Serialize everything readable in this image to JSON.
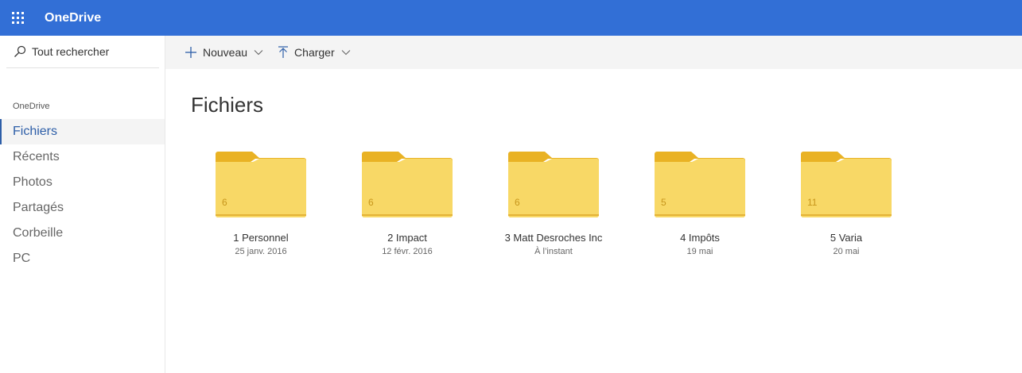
{
  "app": {
    "brand": "OneDrive"
  },
  "icons": {
    "launcher": "app-launcher-icon",
    "search": "search-icon",
    "new": "plus-icon",
    "upload": "upload-icon",
    "folder": "folder-icon",
    "chevron": "chevron-down-icon"
  },
  "colors": {
    "topbar": "#326fd6",
    "accent": "#2d5ea8",
    "folder": "#f8d866",
    "folder_tab": "#e9b224"
  },
  "search": {
    "placeholder": "Tout rechercher"
  },
  "sidebar": {
    "section": "OneDrive",
    "items": [
      {
        "label": "Fichiers",
        "active": true
      },
      {
        "label": "Récents"
      },
      {
        "label": "Photos"
      },
      {
        "label": "Partagés"
      },
      {
        "label": "Corbeille"
      },
      {
        "label": "PC"
      }
    ]
  },
  "commands": {
    "new_label": "Nouveau",
    "upload_label": "Charger"
  },
  "main": {
    "title": "Fichiers",
    "folders": [
      {
        "name": "1 Personnel",
        "date": "25 janv. 2016",
        "count": "6"
      },
      {
        "name": "2 Impact",
        "date": "12 févr. 2016",
        "count": "6"
      },
      {
        "name": "3 Matt Desroches Inc",
        "date": "À l’instant",
        "count": "6"
      },
      {
        "name": "4 Impôts",
        "date": "19 mai",
        "count": "5"
      },
      {
        "name": "5 Varia",
        "date": "20 mai",
        "count": "11"
      }
    ]
  }
}
